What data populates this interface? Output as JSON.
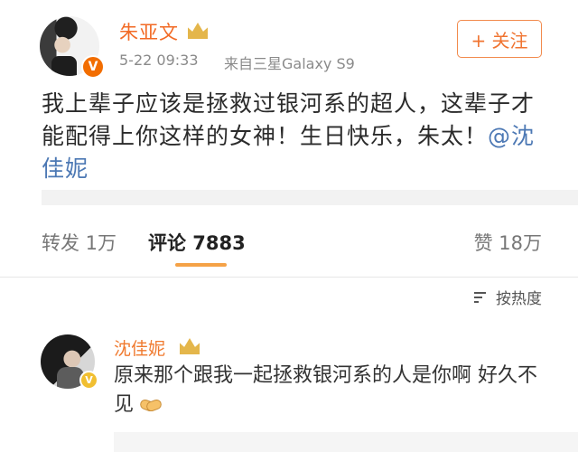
{
  "post": {
    "author": "朱亚文",
    "timestamp": "5-22 09:33",
    "source": "来自三星Galaxy S9",
    "follow_label": "+ 关注",
    "content_main": "我上辈子应该是拯救过银河系的超人，这辈子才能配得上你这样的女神！生日快乐，朱太！",
    "mention": "@沈佳妮",
    "verified_badge": "V"
  },
  "actions": {
    "repost": "转发 1万",
    "comment": "评论 7883",
    "like": "赞 18万"
  },
  "sort": {
    "label": "按热度"
  },
  "comments": [
    {
      "author": "沈佳妮",
      "text": "原来那个跟我一起拯救银河系的人是你啊 好久不见",
      "verified_badge": "V"
    }
  ],
  "icons": {
    "crown": "crown-icon",
    "sort": "sort-icon",
    "handshake": "handshake-icon"
  },
  "colors": {
    "accent": "#f26a25",
    "mention": "#4c78b4",
    "underline": "#f5a247"
  }
}
